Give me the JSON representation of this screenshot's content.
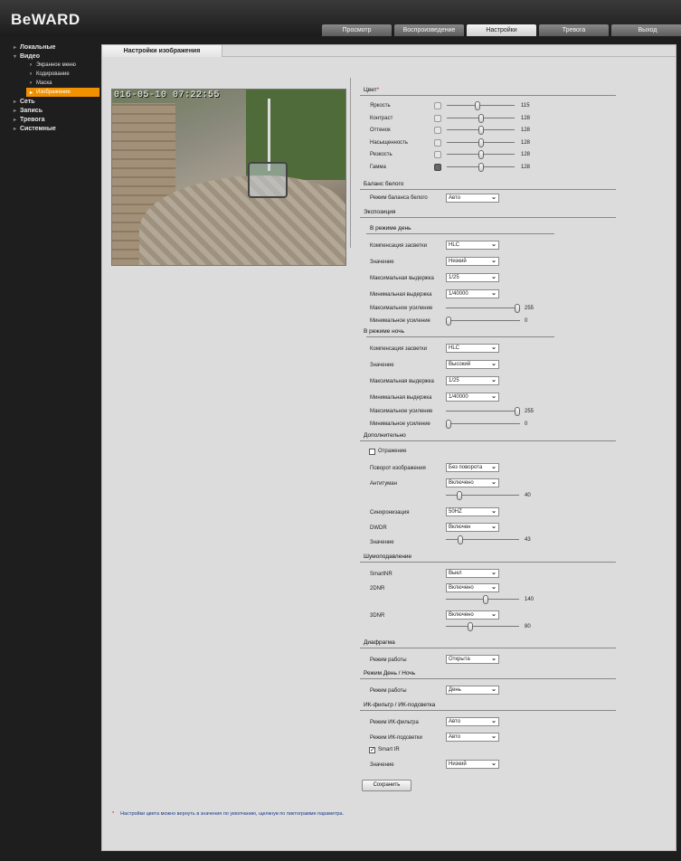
{
  "header": {
    "logo": "BeWARD",
    "tabs": [
      "Просмотр",
      "Воспроизведение",
      "Настройки",
      "Тревога",
      "Выход"
    ],
    "active_tab": "Настройки"
  },
  "sidebar": {
    "items": [
      {
        "label": "Локальные",
        "level": 0
      },
      {
        "label": "Видео",
        "level": 0
      },
      {
        "label": "Экранное меню",
        "level": 1
      },
      {
        "label": "Кодирование",
        "level": 1
      },
      {
        "label": "Маска",
        "level": 1
      },
      {
        "label": "Изображение",
        "level": 1,
        "active": true
      },
      {
        "label": "Сеть",
        "level": 0
      },
      {
        "label": "Запись",
        "level": 0
      },
      {
        "label": "Тревога",
        "level": 0
      },
      {
        "label": "Системные",
        "level": 0
      }
    ]
  },
  "page": {
    "tab_title": "Настройки изображения",
    "preview_timestamp": "016-05-10 07:22:55"
  },
  "color": {
    "title": "Цвет",
    "rows": [
      {
        "label": "Яркость",
        "value": 115
      },
      {
        "label": "Контраст",
        "value": 128
      },
      {
        "label": "Оттенок",
        "value": 128
      },
      {
        "label": "Насыщенность",
        "value": 128
      },
      {
        "label": "Резкость",
        "value": 128
      },
      {
        "label": "Гамма",
        "value": 128
      }
    ]
  },
  "wb": {
    "title": "Баланс белого",
    "mode_label": "Режим баланса белого",
    "mode_value": "Авто"
  },
  "exposure": {
    "title": "Экспозиция",
    "day": {
      "title": "В режиме день",
      "comp_label": "Компенсация засветки",
      "comp_value": "HLC",
      "level_label": "Значение",
      "level_value": "Низкий",
      "max_shutter_label": "Максимальная выдержка",
      "max_shutter_value": "1/25",
      "min_shutter_label": "Минимальная выдержка",
      "min_shutter_value": "1/40000",
      "max_gain_label": "Максимальное усиление",
      "max_gain_value": 255,
      "min_gain_label": "Минимальное усиление",
      "min_gain_value": 0
    },
    "night": {
      "title": "В режиме ночь",
      "comp_label": "Компенсация засветки",
      "comp_value": "HLC",
      "level_label": "Значение",
      "level_value": "Высокий",
      "max_shutter_label": "Максимальная выдержка",
      "max_shutter_value": "1/25",
      "min_shutter_label": "Минимальная выдержка",
      "min_shutter_value": "1/40000",
      "max_gain_label": "Максимальное усиление",
      "max_gain_value": 255,
      "min_gain_label": "Минимальное усиление",
      "min_gain_value": 0
    }
  },
  "extra": {
    "title": "Дополнительно",
    "mirror_label": "Отражение",
    "rotate_label": "Поворот изображения",
    "rotate_value": "Без поворота",
    "defog_label": "Антитуман",
    "defog_value": "Включено",
    "defog_level": 40,
    "sync_label": "Синхронизация",
    "sync_value": "50HZ",
    "dwdr_label": "DWDR",
    "dwdr_value": "Включен",
    "dwdr_level_label": "Значение",
    "dwdr_level": 43
  },
  "nr": {
    "title": "Шумоподавление",
    "smart_label": "SmartNR",
    "smart_value": "Выкл",
    "nr2d_label": "2DNR",
    "nr2d_value": "Включено",
    "nr2d_level": 140,
    "nr3d_label": "3DNR",
    "nr3d_value": "Включено",
    "nr3d_level": 80
  },
  "iris": {
    "title": "Диафрагма",
    "mode_label": "Режим работы",
    "mode_value": "Открыта"
  },
  "daynight": {
    "title": "Режим День / Ночь",
    "mode_label": "Режим работы",
    "mode_value": "День"
  },
  "ir": {
    "title": "ИК-фильтр / ИК-подсветка",
    "filter_label": "Режим ИК-фильтра",
    "filter_value": "Авто",
    "led_label": "Режим ИК-подсветки",
    "led_value": "Авто",
    "smart_ir_label": "Smart IR",
    "level_label": "Значение",
    "level_value": "Низкий"
  },
  "save_label": "Сохранить",
  "footnote": {
    "star": "*",
    "text": "Настройки цвета можно вернуть в значения по умолчанию, щелкнув по пиктограмме параметра."
  },
  "colors": {
    "accent": "#f29100",
    "required": "#dd0000"
  }
}
